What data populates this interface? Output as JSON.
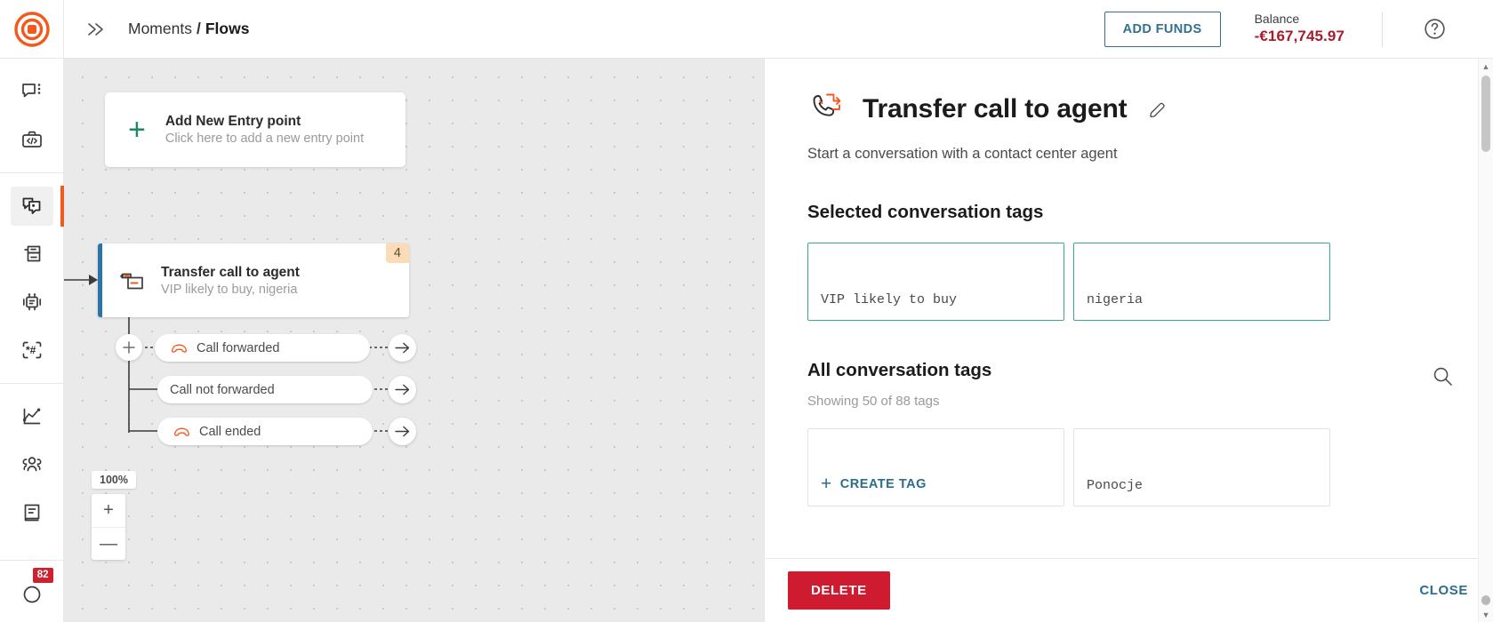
{
  "topbar": {
    "logo_name": "infobip-logo-icon",
    "expand_icon": "double-chevron-right-icon",
    "breadcrumb": {
      "parent": "Moments",
      "separator": "/",
      "current": "Flows"
    },
    "add_funds_label": "ADD FUNDS",
    "balance_label": "Balance",
    "balance_amount": "-€167,745.97",
    "balance_color": "#a61c2b",
    "help_icon": "help-circle-icon"
  },
  "sidebar": {
    "groups": [
      {
        "items": [
          {
            "icon": "conversations-icon",
            "active": false
          },
          {
            "icon": "developer-tools-icon",
            "active": false
          }
        ]
      },
      {
        "items": [
          {
            "icon": "moments-flows-icon",
            "active": true
          },
          {
            "icon": "broadcast-icon",
            "active": false
          },
          {
            "icon": "answers-bot-icon",
            "active": false
          },
          {
            "icon": "ussd-keypad-icon",
            "active": false
          }
        ]
      },
      {
        "items": [
          {
            "icon": "analytics-icon",
            "active": false
          },
          {
            "icon": "people-icon",
            "active": false
          },
          {
            "icon": "catalog-book-icon",
            "active": false
          }
        ]
      }
    ],
    "bottom": {
      "icon": "notifications-icon",
      "badge": "82"
    }
  },
  "canvas": {
    "entry_card": {
      "plus_icon": "plus-icon",
      "title": "Add New Entry point",
      "subtitle": "Click here to add a new entry point"
    },
    "node": {
      "icon": "transfer-call-node-icon",
      "title": "Transfer call to agent",
      "subtitle": "VIP likely to buy, nigeria",
      "count_badge": "4",
      "accent_color": "#2c73a8"
    },
    "add_branch_icon": "plus-circle-icon",
    "branches": [
      {
        "label": "Call forwarded",
        "icon": "phone-hangup-icon",
        "has_icon": true,
        "arrow_icon": "arrow-right-icon"
      },
      {
        "label": "Call not forwarded",
        "icon": "",
        "has_icon": false,
        "arrow_icon": "arrow-right-icon"
      },
      {
        "label": "Call ended",
        "icon": "phone-hangup-icon",
        "has_icon": true,
        "arrow_icon": "arrow-right-icon"
      }
    ],
    "zoom": {
      "level": "100%",
      "zoom_in": "+",
      "zoom_out": "—"
    }
  },
  "panel": {
    "icon": "transfer-call-icon",
    "title": "Transfer call to agent",
    "edit_icon": "pencil-edit-icon",
    "description": "Start a conversation with a contact center agent",
    "selected_section_title": "Selected conversation tags",
    "selected_tags": [
      {
        "label": "VIP likely to buy"
      },
      {
        "label": "nigeria"
      }
    ],
    "all_section_title": "All conversation tags",
    "all_section_sub": "Showing 50 of 88 tags",
    "search_icon": "search-icon",
    "create_tag_label": "CREATE TAG",
    "create_tag_icon": "plus-icon",
    "all_tags": [
      {
        "label": "Ponocje"
      }
    ],
    "footer": {
      "delete_label": "DELETE",
      "close_label": "CLOSE"
    },
    "scrollbar": {
      "up_icon": "scroll-up-arrow-icon",
      "down_icon": "scroll-down-arrow-icon"
    }
  }
}
